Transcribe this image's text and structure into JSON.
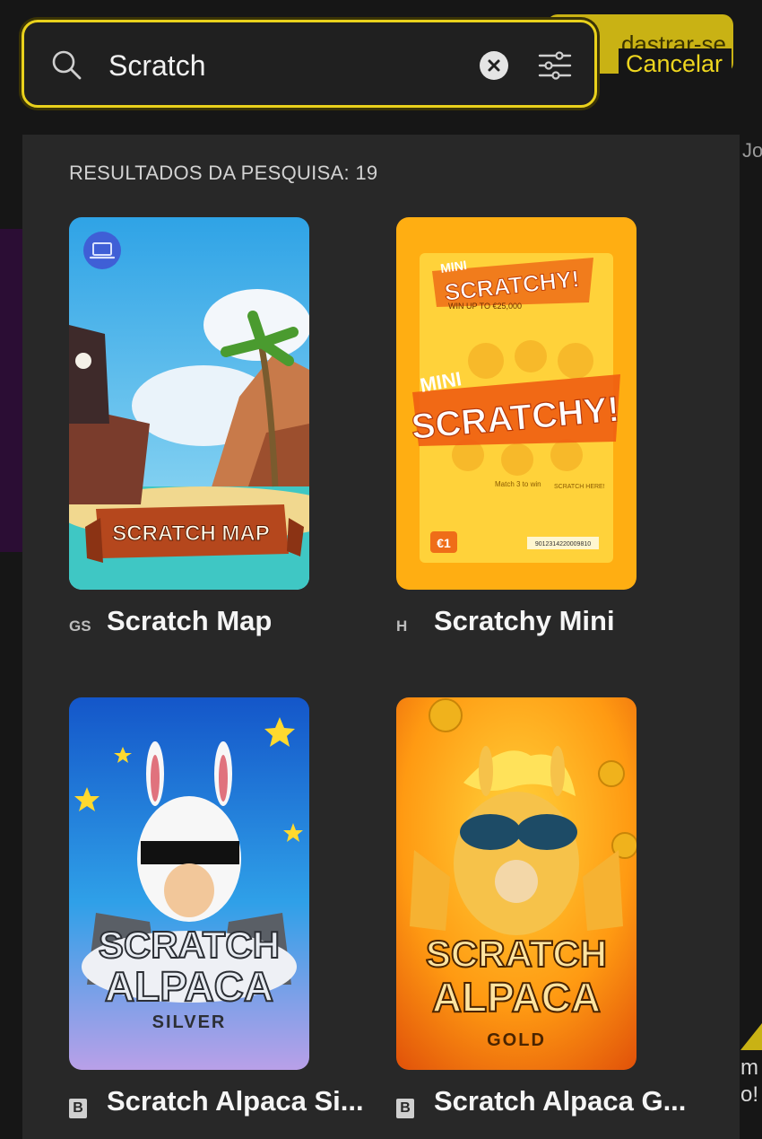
{
  "search": {
    "value": "Scratch",
    "cancel_label": "Cancelar"
  },
  "background": {
    "register_button": "dastrar-se",
    "right_text_top": "Jo",
    "right_text_bottom": "m\no!"
  },
  "results": {
    "heading": "RESULTADOS DA PESQUISA: 19",
    "items": [
      {
        "title": "Scratch Map",
        "provider": "GS",
        "thumb_text": "SCRATCH MAP",
        "desktop_badge": true
      },
      {
        "title": "Scratchy Mini",
        "provider": "H",
        "thumb_text_small_top": "MINI",
        "thumb_text_small": "SCRATCHY!",
        "thumb_text_small_sub": "WIN UP TO €25,000",
        "thumb_text_big_top": "MINI",
        "thumb_text_big": "SCRATCHY!",
        "thumb_match": "Match 3 to win",
        "thumb_scratch_here": "SCRATCH HERE!",
        "thumb_price": "€1",
        "thumb_serial": "9012314220009810"
      },
      {
        "title": "Scratch Alpaca Si...",
        "provider": "B",
        "thumb_line1": "SCRATCH",
        "thumb_line2": "ALPACA",
        "thumb_line3": "SILVER"
      },
      {
        "title": "Scratch Alpaca G...",
        "provider": "B",
        "thumb_line1": "SCRATCH",
        "thumb_line2": "ALPACA",
        "thumb_line3": "GOLD"
      }
    ]
  },
  "icons": {
    "search": "search-icon",
    "clear": "clear-circle-icon",
    "filter": "sliders-icon",
    "desktop": "desktop-icon"
  },
  "colors": {
    "accent": "#eed61f",
    "panel": "#282828",
    "background": "#161616"
  }
}
